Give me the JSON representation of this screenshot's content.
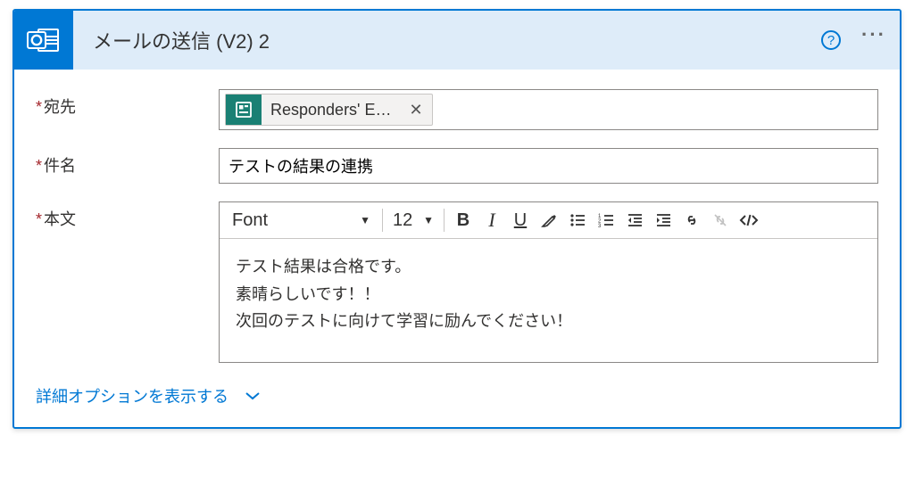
{
  "header": {
    "title": "メールの送信 (V2) 2"
  },
  "fields": {
    "to_label": "宛先",
    "subject_label": "件名",
    "body_label": "本文"
  },
  "to": {
    "token_label": "Responders' E…"
  },
  "subject": {
    "value": "テストの結果の連携"
  },
  "toolbar": {
    "font": "Font",
    "size": "12"
  },
  "body_lines": {
    "l1": "テスト結果は合格です。",
    "l2": "素晴らしいです！！",
    "l3": "次回のテストに向けて学習に励んでください！"
  },
  "advanced": {
    "label": "詳細オプションを表示する"
  }
}
